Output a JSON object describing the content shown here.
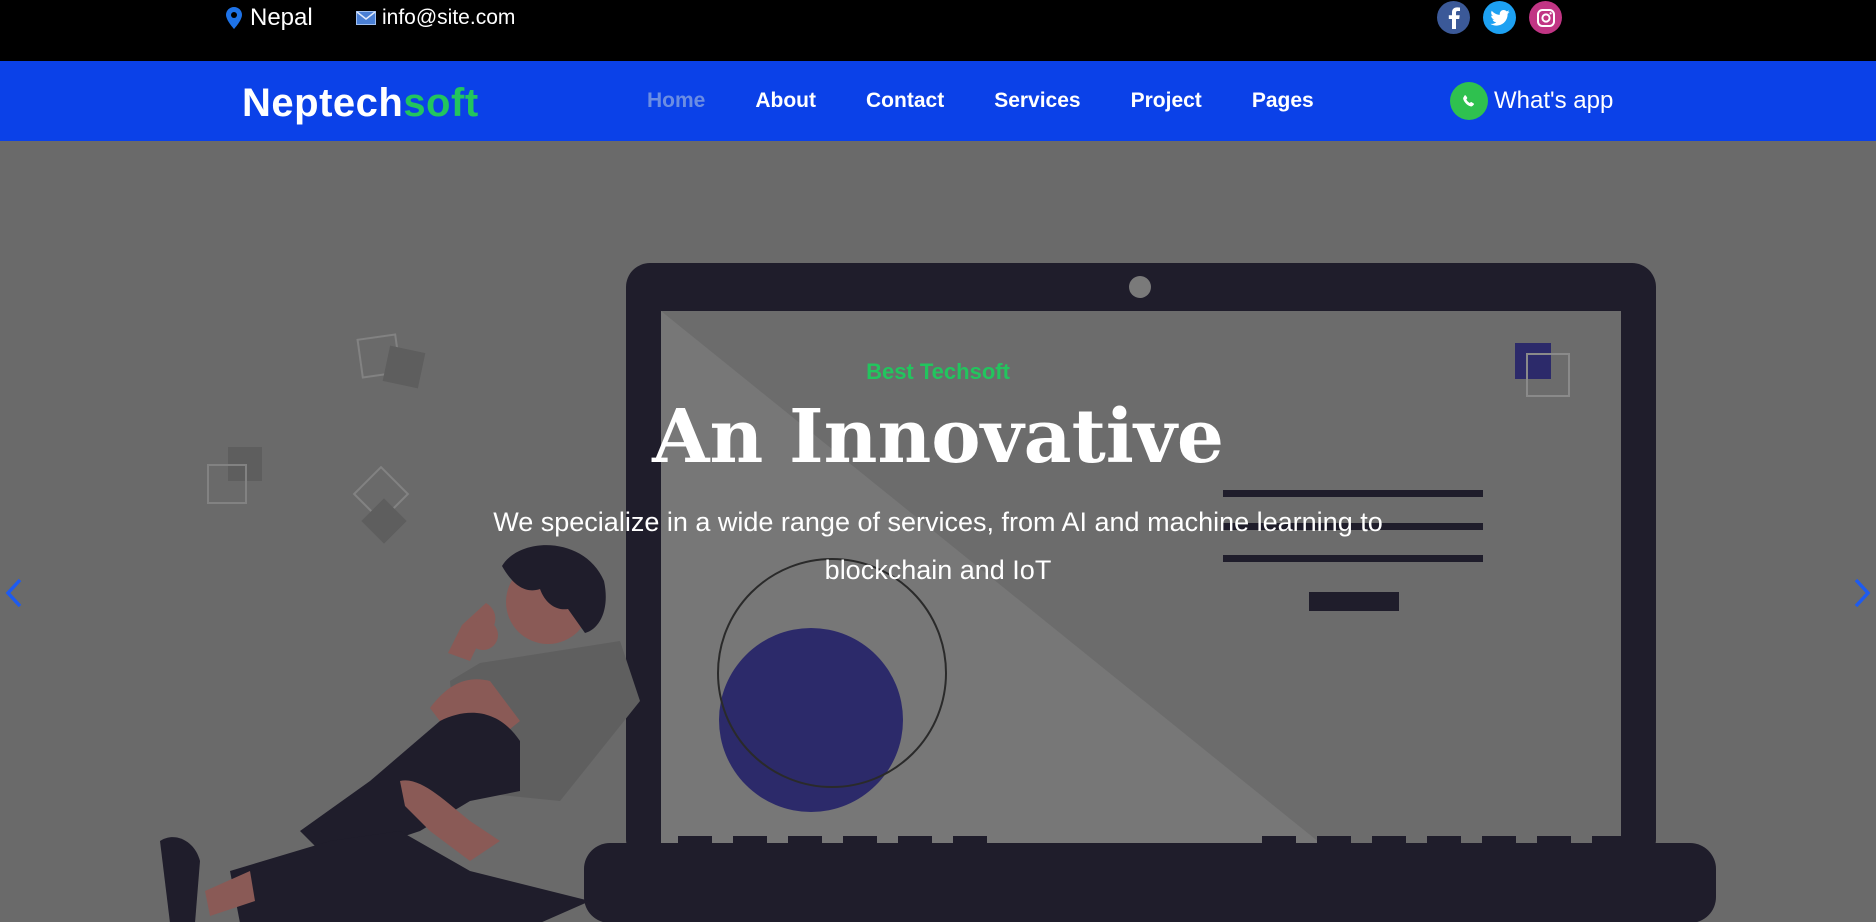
{
  "topbar": {
    "location": "Nepal",
    "email": "info@site.com",
    "socials": [
      {
        "name": "facebook-icon",
        "glyph": "f"
      },
      {
        "name": "twitter-icon",
        "glyph": "t"
      },
      {
        "name": "instagram-icon",
        "glyph": "◎"
      }
    ]
  },
  "navbar": {
    "brand_part1": "Neptech",
    "brand_part2": "soft",
    "menu": [
      "Home",
      "About",
      "Contact",
      "Services",
      "Project",
      "Pages"
    ],
    "active_item": "Home",
    "whatsapp_label": "What's app"
  },
  "hero": {
    "subtitle": "Best Techsoft",
    "headline": "An Innovative",
    "description": "We specialize in a wide range of services, from AI and machine learning to blockchain and IoT"
  },
  "colors": {
    "nav_blue": "#0b41e8",
    "brand_green": "#22c55e",
    "hero_overlay": "#6a6a6a",
    "active_link": "#6b8de3"
  }
}
